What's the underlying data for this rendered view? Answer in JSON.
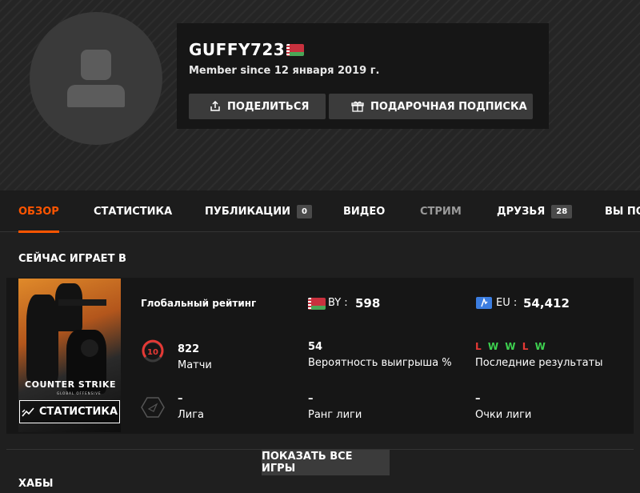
{
  "profile": {
    "username": "GUFFY723",
    "member_since": "Member since 12 января 2019 г.",
    "share_button": "ПОДЕЛИТЬСЯ",
    "gift_button": "ПОДАРОЧНАЯ ПОДПИСКА"
  },
  "nav": {
    "items": [
      {
        "label": "ОБЗОР",
        "active": true
      },
      {
        "label": "СТАТИСТИКА"
      },
      {
        "label": "ПУБЛИКАЦИИ",
        "badge": "0"
      },
      {
        "label": "ВИДЕО"
      },
      {
        "label": "СТРИМ"
      },
      {
        "label": "ДРУЗЬЯ",
        "badge": "28"
      },
      {
        "label": "ВЫ ПО"
      }
    ]
  },
  "now_playing": {
    "title": "СЕЙЧАС ИГРАЕТ В",
    "game": {
      "logo_text": "COUNTER STRIKE",
      "logo_sub": "GLOBAL OFFENSIVE",
      "stats_button": "СТАТИСТИКА"
    },
    "global_rating_label": "Глобальный рейтинг",
    "region_by": {
      "code": "BY",
      "value": "598"
    },
    "region_eu": {
      "code": "EU",
      "value": "54,412"
    },
    "level_badge": "10",
    "matches": {
      "value": "822",
      "label": "Матчи"
    },
    "win_rate": {
      "value": "54",
      "label": "Вероятность выигрыша %"
    },
    "recent_results": {
      "values": [
        "L",
        "W",
        "W",
        "L",
        "W"
      ],
      "label": "Последние результаты"
    },
    "league": {
      "value": "–",
      "label": "Лига"
    },
    "league_rank": {
      "value": "–",
      "label": "Ранг лиги"
    },
    "league_points": {
      "value": "–",
      "label": "Очки лиги"
    }
  },
  "show_all_games": "ПОКАЗАТЬ ВСЕ ИГРЫ",
  "hubs_title": "ХАБЫ",
  "colors": {
    "accent": "#ff5500",
    "win": "#3dd04f",
    "loss": "#e53935",
    "level_ring": "#e53935"
  }
}
